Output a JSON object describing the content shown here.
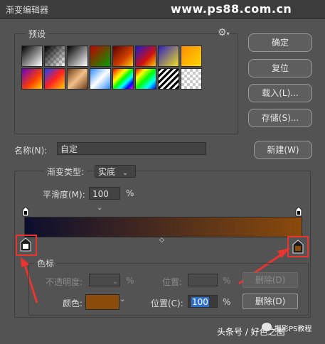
{
  "window": {
    "title": "渐变编辑器"
  },
  "watermark": "www.ps88.com.cn",
  "presets": {
    "label": "预设",
    "gear_icon": "gear-icon",
    "swatches": [
      {
        "bg": "linear-gradient(135deg,#000 0%,#fff 100%)"
      },
      {
        "bg": "checker-black"
      },
      {
        "bg": "linear-gradient(135deg,#000 0%,#fff 100%)"
      },
      {
        "bg": "linear-gradient(135deg,#c00000 0%,#00a000 100%)"
      },
      {
        "bg": "linear-gradient(135deg,#5a0000 0%,#d04000 60%,#ffcc00 100%)"
      },
      {
        "bg": "linear-gradient(135deg,#1b1bd0 0%,#d01010 60%,#ffcc00 100%)"
      },
      {
        "bg": "linear-gradient(135deg,#3020c0 0%,#f0e020 100%)"
      },
      {
        "bg": "linear-gradient(135deg,#ff8c00 0%,#ffd800 100%)"
      },
      {
        "bg": "linear-gradient(135deg,#6a00c8 0%,#ff4000 60%,#ffd000 100%)"
      },
      {
        "bg": "linear-gradient(135deg,#1e40ff 0%,#ff2020 50%,#ffcc00 100%)"
      },
      {
        "bg": "linear-gradient(135deg,#6b3a16 0%,#f3c08a 50%,#6b3a16 100%)"
      },
      {
        "bg": "linear-gradient(135deg,#2a8cff 0%,#ffffff 50%,#2a8cff 100%)"
      },
      {
        "bg": "linear-gradient(135deg,#ff0000,#ff8800,#ffff00,#00ff00,#00ffff,#0000ff,#ff00ff)"
      },
      {
        "bg": "linear-gradient(135deg,#ff0000,#ffff00,#00ff00,#00ffff,#0000ff)"
      },
      {
        "bg": "stripes"
      },
      {
        "bg": "checker"
      }
    ]
  },
  "buttons": {
    "ok": "确定",
    "reset": "复位",
    "load": "载入(L)...",
    "save": "存储(S)...",
    "new": "新建(W)"
  },
  "name": {
    "label": "名称(N):",
    "value": "自定"
  },
  "gradient": {
    "type_label": "渐变类型:",
    "type_value": "实底",
    "smooth_label": "平滑度(M):",
    "smooth_value": "100",
    "smooth_unit": "%",
    "start_color": "#0c0e2e",
    "end_color": "#8a4a0c",
    "midpoint_icon": "diamond-icon"
  },
  "stops": {
    "legend": "色标",
    "opacity_label": "不透明度:",
    "opacity_unit": "%",
    "opacity_pos_label": "位置:",
    "opacity_pos_unit": "%",
    "opacity_delete": "删除(D)",
    "color_label": "颜色:",
    "color_value": "#8b4b0b",
    "color_pos_label": "位置(C):",
    "color_pos_value": "100",
    "color_pos_unit": "%",
    "color_delete": "删除(D)"
  },
  "footer": {
    "brand": "头条号 / 好色之图",
    "logo_text": "摄影PS教程"
  },
  "accent": "#e8352f"
}
